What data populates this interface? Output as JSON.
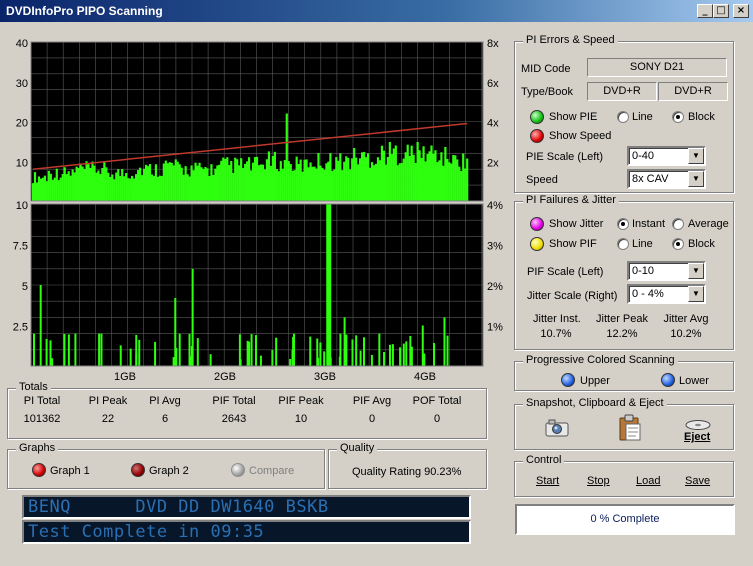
{
  "window": {
    "title": "DVDInfoPro PIPO Scanning",
    "buttons": {
      "minimize": "_",
      "maximize": "□",
      "close": "×"
    }
  },
  "graph": {
    "top_left_ticks": [
      "40",
      "30",
      "20",
      "10"
    ],
    "top_right_ticks": [
      "8x",
      "6x",
      "4x",
      "2x"
    ],
    "bottom_left_ticks": [
      "10",
      "7.5",
      "5",
      "2.5"
    ],
    "bottom_right_ticks": [
      "4%",
      "3%",
      "2%",
      "1%"
    ],
    "x_ticks": [
      "1GB",
      "2GB",
      "3GB",
      "4GB"
    ],
    "colors": {
      "background": "#000000",
      "grid": "#5a5a5a",
      "pie": "#2eff0e",
      "speed": "#c0392b"
    }
  },
  "chart_data": [
    {
      "type": "bar",
      "title": "",
      "xlabel": "",
      "ylabel": "",
      "x_tick_labels": [
        "1GB",
        "2GB",
        "3GB",
        "4GB"
      ],
      "ylim": [
        0,
        40
      ],
      "y2lim": [
        0,
        8
      ],
      "series": [
        {
          "name": "PIE",
          "values": [
            6,
            7,
            7,
            8,
            8,
            7,
            7,
            8,
            8,
            9,
            8,
            8,
            8,
            9,
            9,
            9,
            10,
            9,
            9,
            10,
            10,
            10,
            11,
            11,
            12,
            12,
            12,
            12,
            11,
            10
          ],
          "peak": 22
        },
        {
          "name": "Speed",
          "values": [
            1.6,
            3.9
          ],
          "units": "x"
        }
      ]
    },
    {
      "type": "bar",
      "title": "",
      "xlabel": "",
      "ylabel": "",
      "ylim": [
        0,
        10
      ],
      "y2lim": [
        0,
        4
      ],
      "series": [
        {
          "name": "PIF",
          "values": [
            {
              "x": 0.02,
              "y": 5
            },
            {
              "x": 0.1,
              "y": 2
            },
            {
              "x": 0.16,
              "y": 2
            },
            {
              "x": 0.33,
              "y": 4.2
            },
            {
              "x": 0.37,
              "y": 6
            },
            {
              "x": 0.5,
              "y": 1.5
            },
            {
              "x": 0.6,
              "y": 1
            },
            {
              "x": 0.68,
              "y": 10
            },
            {
              "x": 0.72,
              "y": 3
            },
            {
              "x": 0.8,
              "y": 2
            },
            {
              "x": 0.9,
              "y": 2.5
            },
            {
              "x": 0.95,
              "y": 3
            }
          ]
        }
      ]
    }
  ],
  "pi_errors": {
    "title": "PI Errors & Speed",
    "mid_label": "MID Code",
    "mid_value": "SONY      D21",
    "type_label": "Type/Book",
    "type_value": "DVD+R",
    "book_value": "DVD+R",
    "show_pie": "Show PIE",
    "show_speed": "Show Speed",
    "line": "Line",
    "block": "Block",
    "pie_scale_label": "PIE Scale (Left)",
    "pie_scale_value": "0-40",
    "speed_label": "Speed",
    "speed_value": "8x CAV"
  },
  "pi_failures": {
    "title": "PI Failures & Jitter",
    "show_jitter": "Show Jitter",
    "instant": "Instant",
    "average": "Average",
    "show_pif": "Show PIF",
    "line": "Line",
    "block": "Block",
    "pif_scale_label": "PIF Scale (Left)",
    "pif_scale_value": "0-10",
    "jitter_scale_label": "Jitter Scale (Right)",
    "jitter_scale_value": "0 - 4%",
    "jitter_inst_label": "Jitter Inst.",
    "jitter_inst_value": "10.7%",
    "jitter_peak_label": "Jitter Peak",
    "jitter_peak_value": "12.2%",
    "jitter_avg_label": "Jitter Avg",
    "jitter_avg_value": "10.2%"
  },
  "progressive": {
    "title": "Progressive Colored Scanning",
    "upper": "Upper",
    "lower": "Lower"
  },
  "snapshot": {
    "title": "Snapshot,  Clipboard  & Eject",
    "eject": "Eject"
  },
  "control": {
    "title": "Control",
    "start": "Start",
    "stop": "Stop",
    "load": "Load",
    "save": "Save",
    "progress": "0 % Complete"
  },
  "totals": {
    "title": "Totals",
    "headers": [
      "PI Total",
      "PI Peak",
      "PI Avg",
      "PIF Total",
      "PIF Peak",
      "PIF Avg",
      "POF Total"
    ],
    "values": [
      "101362",
      "22",
      "6",
      "2643",
      "10",
      "0",
      "0"
    ]
  },
  "graphs": {
    "title": "Graphs",
    "graph1": "Graph 1",
    "graph2": "Graph 2",
    "compare": "Compare"
  },
  "quality": {
    "title": "Quality",
    "rating": "Quality Rating 90.23%"
  },
  "lcd": {
    "line1": "BENQ      DVD DD DW1640 BSKB",
    "line2": "Test Complete in 09:35"
  }
}
